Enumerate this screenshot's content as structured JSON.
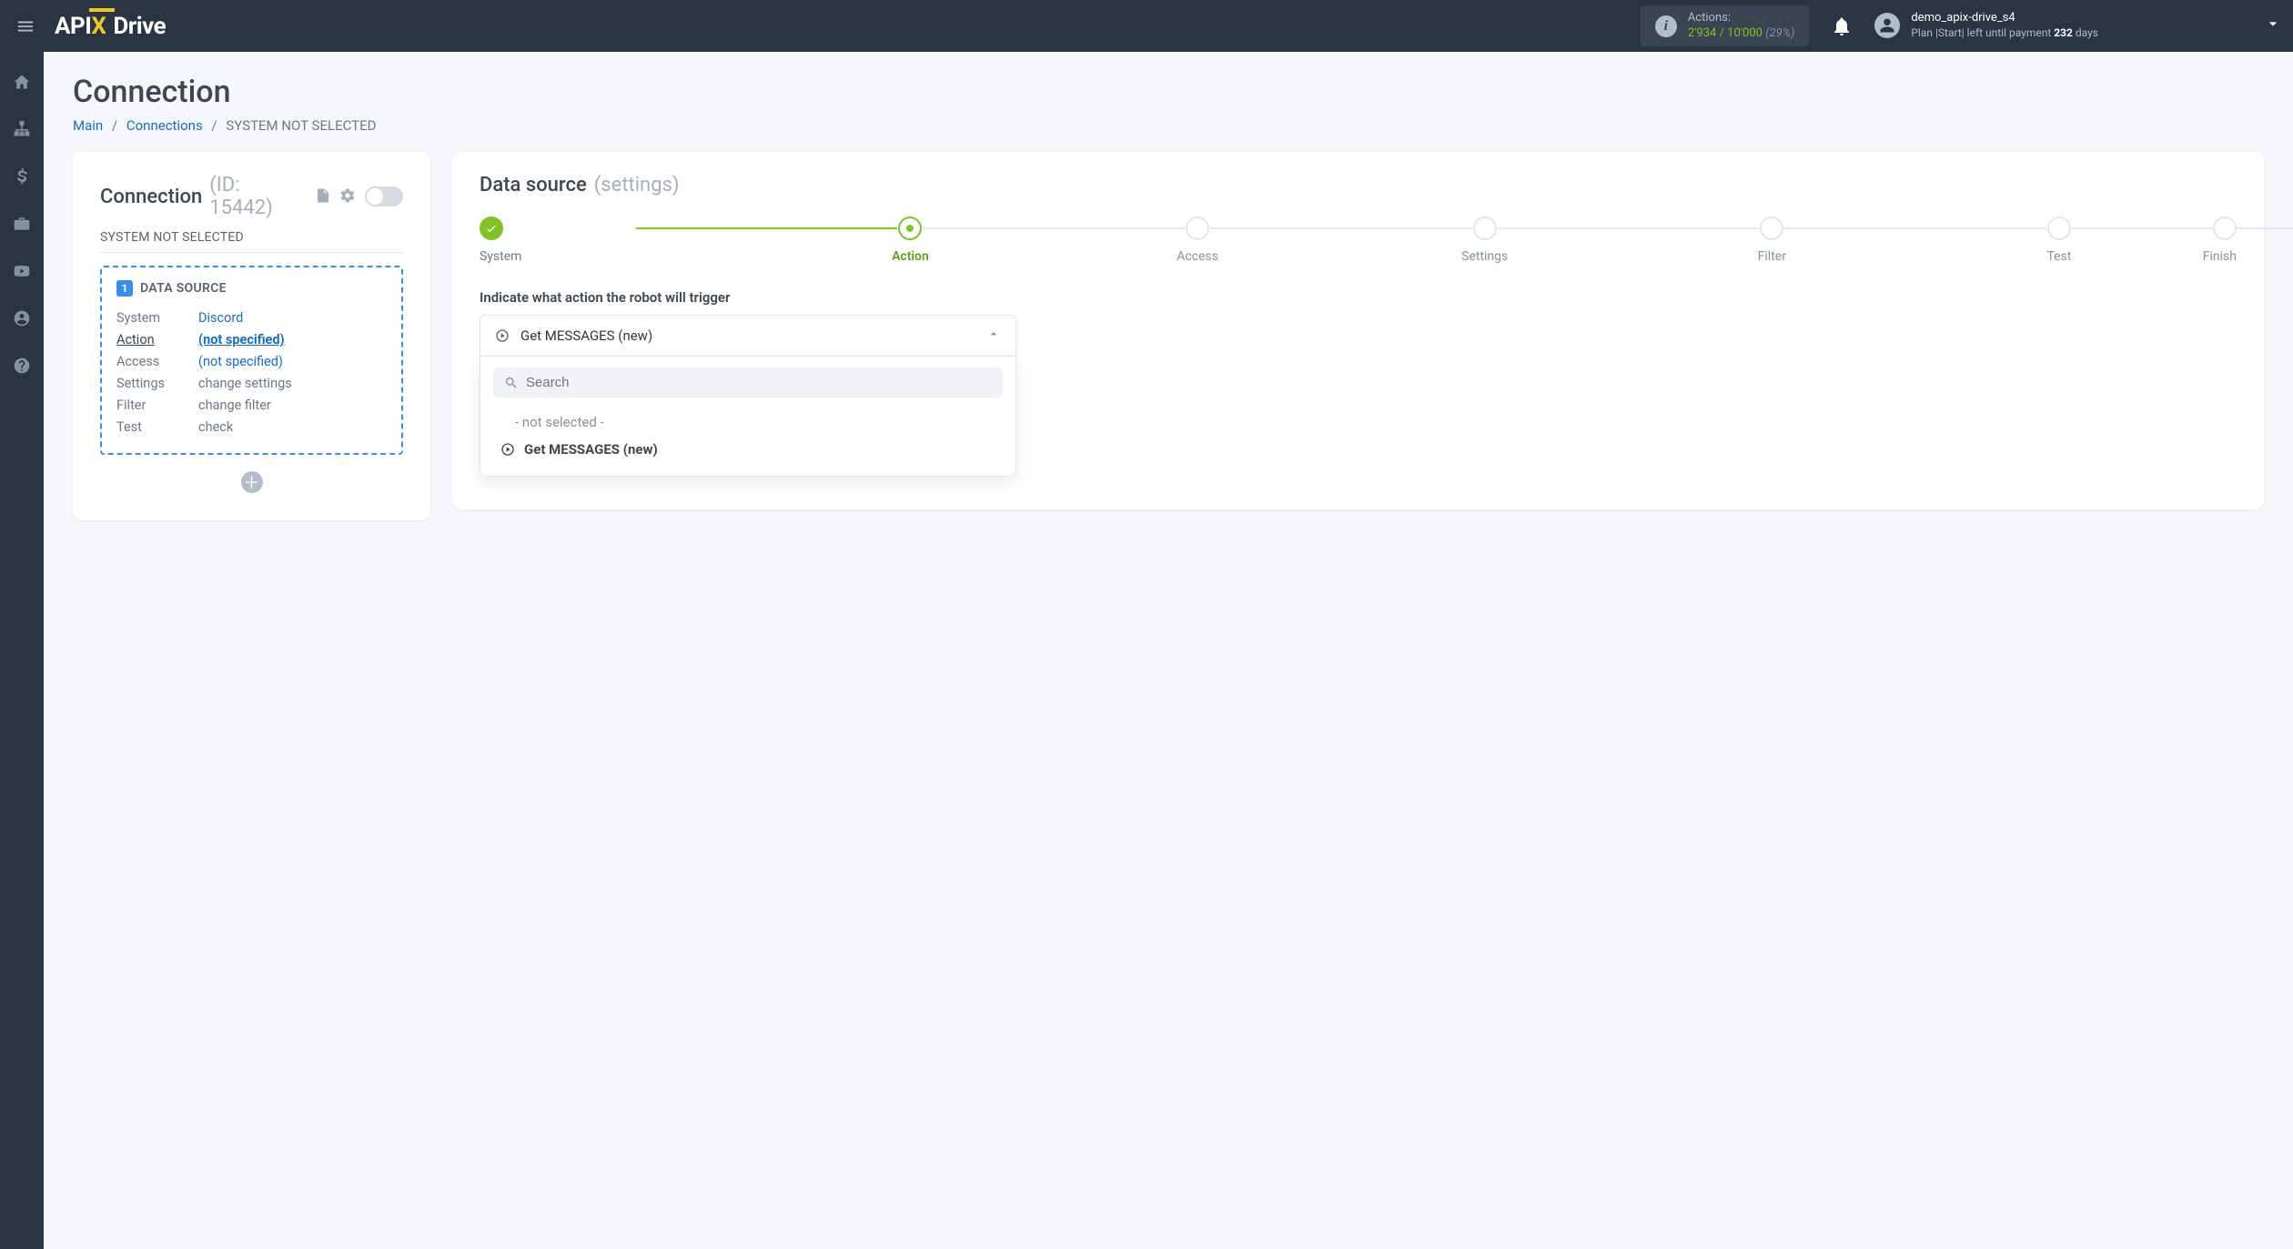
{
  "header": {
    "actions_label": "Actions:",
    "actions_used": "2'934",
    "actions_sep": "/",
    "actions_total": "10'000",
    "actions_pct": "(29%)",
    "user_name": "demo_apix-drive_s4",
    "plan_prefix": "Plan |Start| left until payment ",
    "plan_days": "232",
    "plan_suffix": " days"
  },
  "page": {
    "title": "Connection",
    "crumb_main": "Main",
    "crumb_conns": "Connections",
    "crumb_current": "SYSTEM NOT SELECTED"
  },
  "left": {
    "hdr_title": "Connection",
    "hdr_id": "(ID: 15442)",
    "subhdr": "SYSTEM NOT SELECTED",
    "ds_badge": "1",
    "ds_title": "DATA SOURCE",
    "rows": [
      {
        "label": "System",
        "value": "Discord",
        "cls": "link"
      },
      {
        "label": "Action",
        "value": "(not specified)",
        "cls": "link u",
        "active": true
      },
      {
        "label": "Access",
        "value": "(not specified)",
        "cls": "link"
      },
      {
        "label": "Settings",
        "value": "change settings",
        "cls": "gray"
      },
      {
        "label": "Filter",
        "value": "change filter",
        "cls": "gray"
      },
      {
        "label": "Test",
        "value": "check",
        "cls": "gray"
      }
    ]
  },
  "right": {
    "hdr_title": "Data source",
    "hdr_sub": "(settings)",
    "steps": [
      "System",
      "Action",
      "Access",
      "Settings",
      "Filter",
      "Test",
      "Finish"
    ],
    "field_label": "Indicate what action the robot will trigger",
    "select_value": "Get MESSAGES (new)",
    "search_placeholder": "Search",
    "opt_empty": "- not selected -",
    "opt_value": "Get MESSAGES (new)"
  }
}
